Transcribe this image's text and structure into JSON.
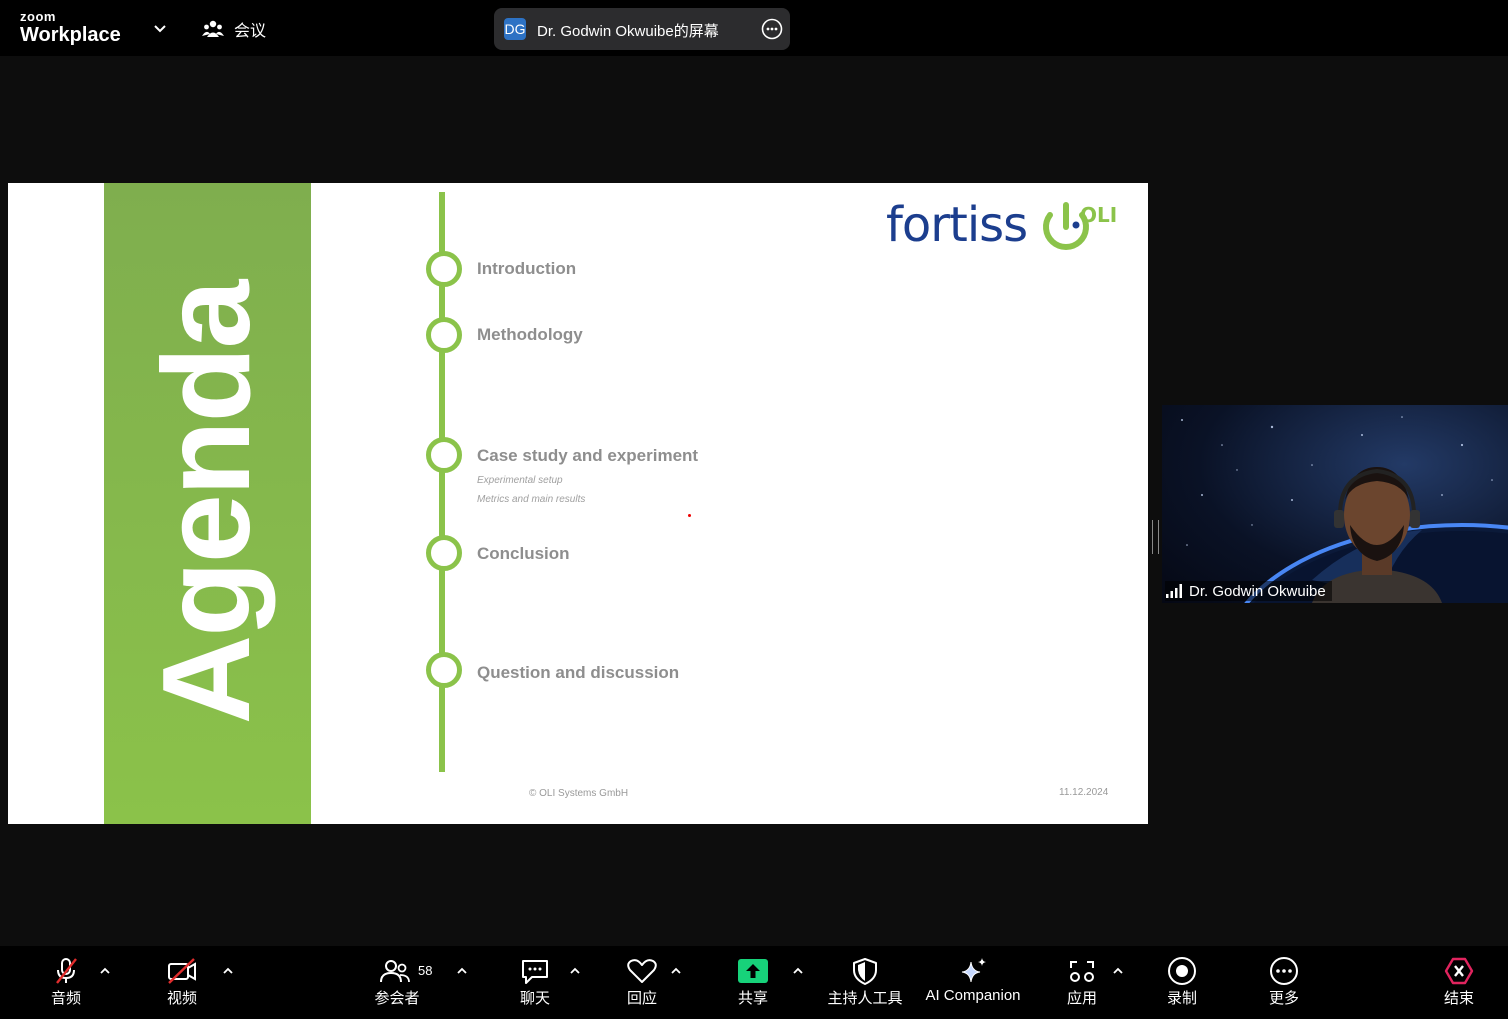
{
  "top_bar": {
    "brand_small": "zoom",
    "brand_big": "Workplace",
    "meeting_label": "会议",
    "share_avatar": "DG",
    "share_title": "Dr. Godwin Okwuibe的屏幕"
  },
  "slide": {
    "title": "Agenda",
    "items": [
      {
        "label": "Introduction"
      },
      {
        "label": "Methodology"
      },
      {
        "label": "Case study and experiment",
        "subs": [
          "Experimental setup",
          "Metrics and main results"
        ]
      },
      {
        "label": "Conclusion"
      },
      {
        "label": "Question and discussion"
      }
    ],
    "logo_text": "fortiss",
    "logo_partner": "OLI",
    "footer_copyright": "© OLI Systems GmbH",
    "footer_date": "11.12.2024"
  },
  "video": {
    "speaker_name": "Dr. Godwin Okwuibe"
  },
  "toolbar": {
    "audio": "音频",
    "video": "视频",
    "participants": "参会者",
    "participants_count": "58",
    "chat": "聊天",
    "react": "回应",
    "share": "共享",
    "host_tools": "主持人工具",
    "ai_companion": "AI Companion",
    "apps": "应用",
    "record": "录制",
    "more": "更多",
    "end": "结束"
  },
  "colors": {
    "accent_green": "#8bc34a",
    "share_green": "#17d27a",
    "end_red": "#e0245e",
    "mute_red": "#e02d2d",
    "fortiss_blue": "#1c3e8e"
  }
}
